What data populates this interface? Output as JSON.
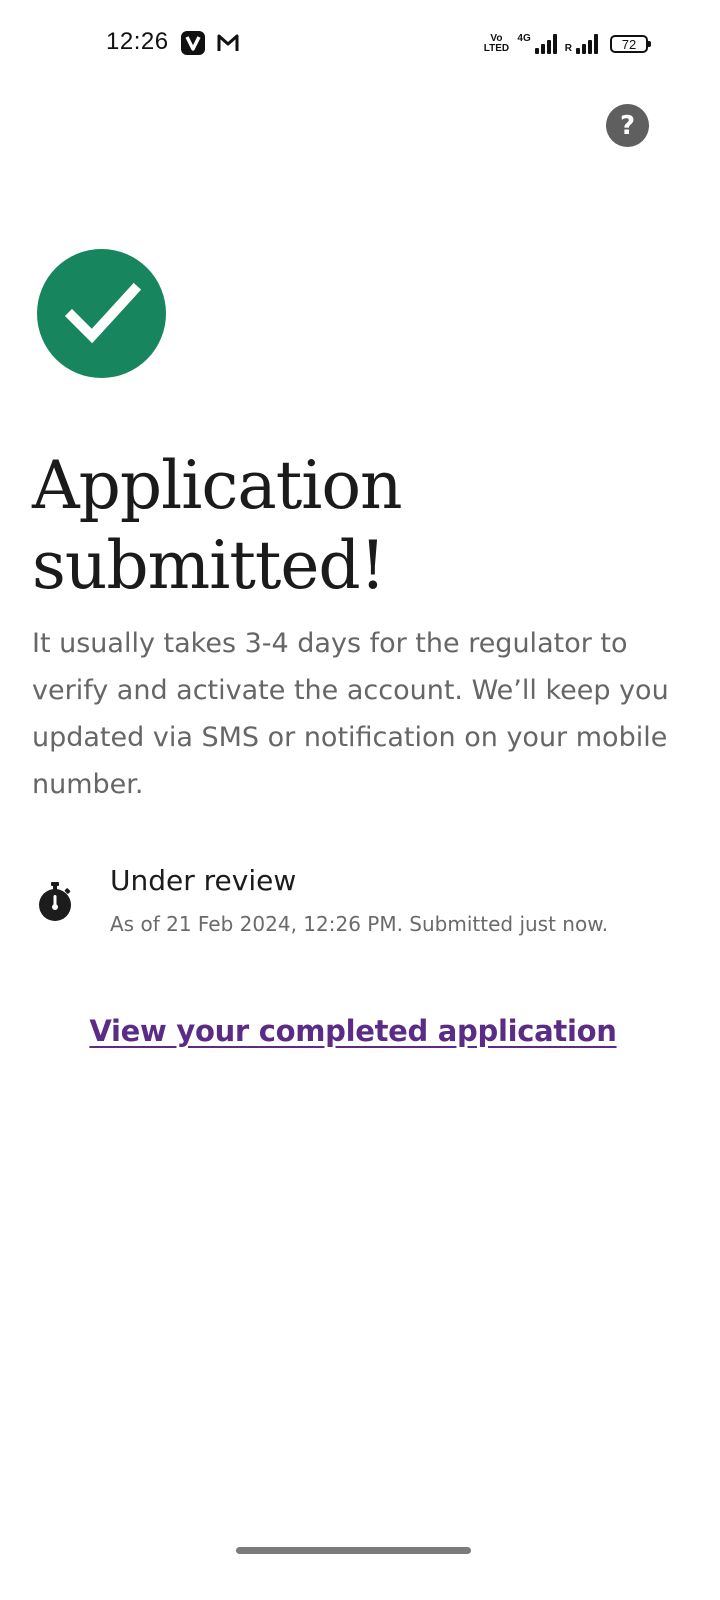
{
  "status_bar": {
    "time": "12:26",
    "volte_top": "Vo",
    "volte_bottom": "LTED",
    "network_type": "4G",
    "roaming_label": "R",
    "battery_level": "72",
    "apps": [
      "vi-app-icon",
      "gmail-icon"
    ]
  },
  "help": {
    "label": "?",
    "icon": "help-icon"
  },
  "success": {
    "icon": "check-icon",
    "color": "#17865e"
  },
  "title": "Application submitted!",
  "description": "It usually takes 3-4 days for the regulator to verify and activate the account. We’ll keep you updated via SMS or notification on your mobile number.",
  "status": {
    "icon": "timer-icon",
    "title": "Under review",
    "subtitle": "As of 21 Feb 2024, 12:26 PM. Submitted just now."
  },
  "link": {
    "label": "View your completed application",
    "color": "#5b2c86"
  }
}
